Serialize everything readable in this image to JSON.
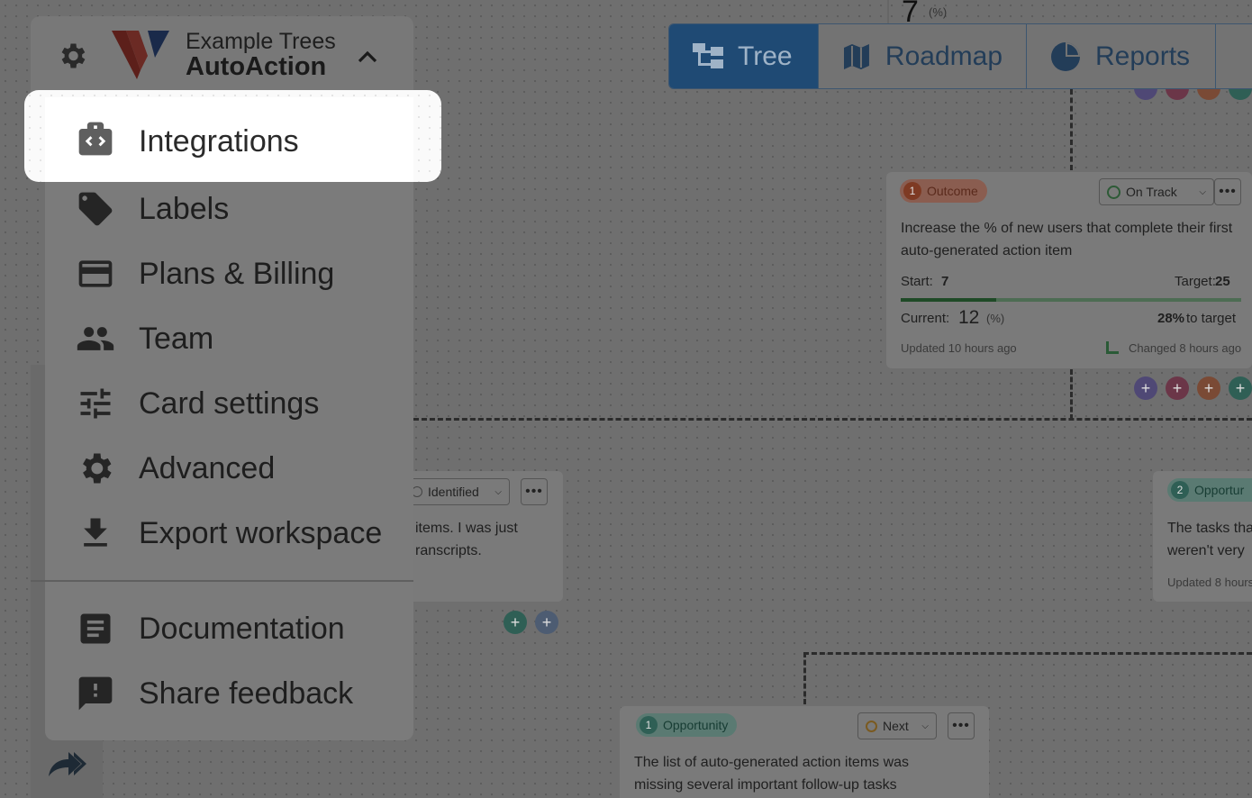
{
  "workspace": {
    "org_name": "Example Trees",
    "workspace_name": "AutoAction",
    "settings_icon": "gear-icon",
    "collapse_icon": "chevron-up-icon",
    "brand_colors": {
      "red": "#c0392b",
      "blue": "#1f3a8a"
    }
  },
  "nav_tabs": [
    {
      "label": "Tree",
      "icon": "tree-icon",
      "active": true
    },
    {
      "label": "Roadmap",
      "icon": "map-icon",
      "active": false
    },
    {
      "label": "Reports",
      "icon": "pie-chart-icon",
      "active": false
    }
  ],
  "menu": {
    "items": [
      {
        "label": "Integrations",
        "icon": "integrations-icon"
      },
      {
        "label": "Labels",
        "icon": "tag-icon"
      },
      {
        "label": "Plans & Billing",
        "icon": "credit-card-icon"
      },
      {
        "label": "Team",
        "icon": "people-icon"
      },
      {
        "label": "Card settings",
        "icon": "sliders-icon"
      },
      {
        "label": "Advanced",
        "icon": "gear-icon"
      },
      {
        "label": "Export workspace",
        "icon": "download-icon"
      }
    ],
    "secondary_items": [
      {
        "label": "Documentation",
        "icon": "document-icon"
      },
      {
        "label": "Share feedback",
        "icon": "feedback-icon"
      }
    ]
  },
  "top_metric": {
    "value": "7",
    "unit": "(%)"
  },
  "outcome_card": {
    "number": "1",
    "type_label": "Outcome",
    "status": "On Track",
    "more": "•••",
    "description": "Increase the % of new users that complete their first auto-generated action item",
    "start_label": "Start:",
    "start_value": "7",
    "target_label": "Target:",
    "target_value": "25",
    "progress": 0.28,
    "current_label": "Current:",
    "current_value": "12",
    "current_unit": "(%)",
    "to_target_pct": "28%",
    "to_target_text": "to target",
    "updated": "Updated 10 hours ago",
    "changed": "Changed 8 hours ago"
  },
  "left_card": {
    "status": "Identified",
    "more": "•••",
    "line1": "items. I was just",
    "line2": "ranscripts."
  },
  "right_card": {
    "number": "2",
    "type_label": "Opportur",
    "line1": "The tasks tha",
    "line2": "weren't very",
    "updated": "Updated 8 hours"
  },
  "bottom_card": {
    "number": "1",
    "type_label": "Opportunity",
    "status": "Next",
    "more": "•••",
    "line1": "The list of auto-generated action items was",
    "line2": "missing several important follow-up tasks"
  },
  "plus_glyph": "+"
}
